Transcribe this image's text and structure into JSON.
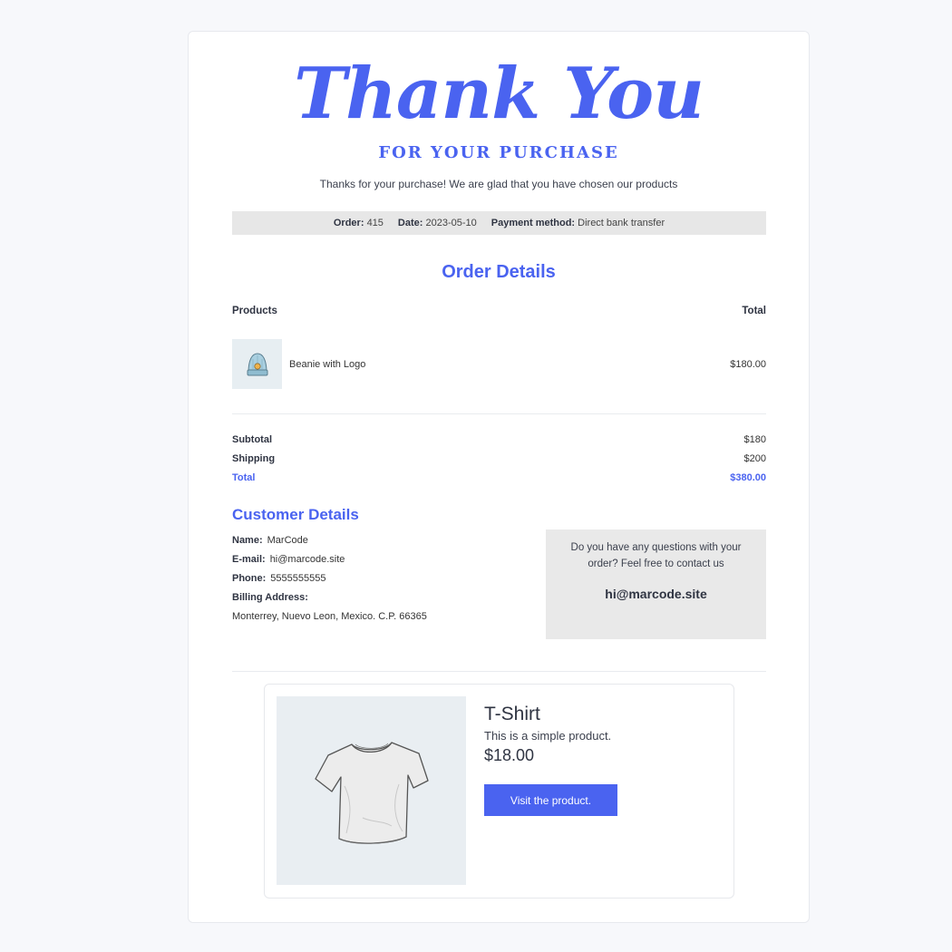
{
  "header": {
    "title": "Thank You",
    "subtitle": "FOR YOUR PURCHASE",
    "message": "Thanks for your purchase! We are glad that you have chosen our products"
  },
  "order_info": {
    "order_label": "Order:",
    "order_value": "415",
    "date_label": "Date:",
    "date_value": "2023-05-10",
    "payment_label": "Payment method:",
    "payment_value": "Direct bank transfer"
  },
  "order_details": {
    "title": "Order Details",
    "col_products": "Products",
    "col_total": "Total",
    "items": [
      {
        "name": "Beanie with Logo",
        "price": "$180.00",
        "icon": "beanie-image"
      }
    ],
    "subtotal_label": "Subtotal",
    "subtotal_value": "$180",
    "shipping_label": "Shipping",
    "shipping_value": "$200",
    "total_label": "Total",
    "total_value": "$380.00"
  },
  "customer": {
    "title": "Customer Details",
    "name_label": "Name:",
    "name_value": "MarCode",
    "email_label": "E-mail:",
    "email_value": "hi@marcode.site",
    "phone_label": "Phone:",
    "phone_value": "5555555555",
    "billing_label": "Billing Address:",
    "billing_value": "Monterrey, Nuevo Leon, Mexico. C.P. 66365"
  },
  "contact": {
    "text": "Do you have any questions with your order? Feel free to contact us",
    "email": "hi@marcode.site"
  },
  "recommended": {
    "name": "T-Shirt",
    "description": "This is a simple product.",
    "price": "$18.00",
    "button_label": "Visit the product.",
    "icon": "tshirt-image"
  },
  "colors": {
    "accent": "#4a63f0",
    "page_bg": "#f7f8fb",
    "bar_bg": "#e7e7e7"
  }
}
